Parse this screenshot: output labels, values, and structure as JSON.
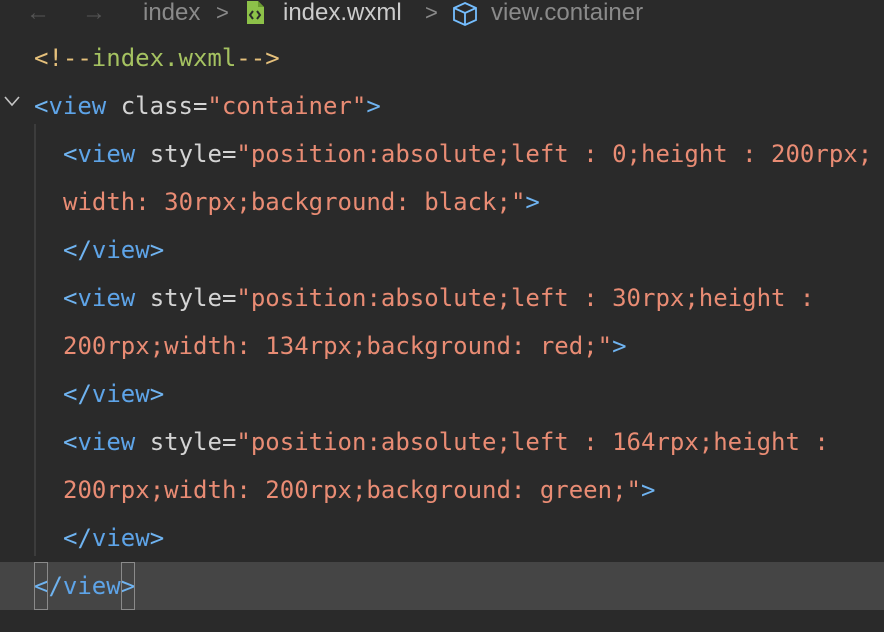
{
  "breadcrumb": {
    "back_arrow": "←",
    "forward_arrow": "→",
    "folder": "index",
    "separator": ">",
    "file": "index.wxml",
    "element": "view.container",
    "file_icon": "file-code-icon",
    "element_icon": "cube-icon"
  },
  "code": {
    "line1": {
      "open": "<!--",
      "text": "index.wxml",
      "close": "-->"
    },
    "line2": {
      "lt": "<",
      "tag": "view",
      "attr": " class",
      "eq": "=",
      "q1": "\"",
      "value": "container",
      "q2": "\"",
      "gt": ">"
    },
    "line3": {
      "lt": "<",
      "tag": "view",
      "attr": " style",
      "eq": "=",
      "q1": "\"",
      "value": "position:absolute;left : 0;height : 200rpx;"
    },
    "line4": {
      "value": "width: 30rpx;background: black;",
      "q2": "\"",
      "gt": ">"
    },
    "line5": {
      "lt": "</",
      "tag": "view",
      "gt": ">"
    },
    "line6": {
      "lt": "<",
      "tag": "view",
      "attr": " style",
      "eq": "=",
      "q1": "\"",
      "value": "position:absolute;left : 30rpx;height :"
    },
    "line7": {
      "value": "200rpx;width: 134rpx;background: red;",
      "q2": "\"",
      "gt": ">"
    },
    "line8": {
      "lt": "</",
      "tag": "view",
      "gt": ">"
    },
    "line9": {
      "lt": "<",
      "tag": "view",
      "attr": " style",
      "eq": "=",
      "q1": "\"",
      "value": "position:absolute;left : 164rpx;height :"
    },
    "line10": {
      "value": "200rpx;width: 200rpx;background: green;",
      "q2": "\"",
      "gt": ">"
    },
    "line11": {
      "lt": "</",
      "tag": "view",
      "gt": ">"
    },
    "line12": {
      "lt": "<",
      "slash": "/",
      "tag": "view",
      "gt": ">"
    }
  },
  "colors": {
    "background": "#2a2a2a",
    "active_line": "#454545",
    "tag": "#5ea4e8",
    "string": "#e98c74",
    "comment": "#a5c261",
    "comment_delimiter": "#e5c07b",
    "attribute": "#d4d4d4"
  }
}
